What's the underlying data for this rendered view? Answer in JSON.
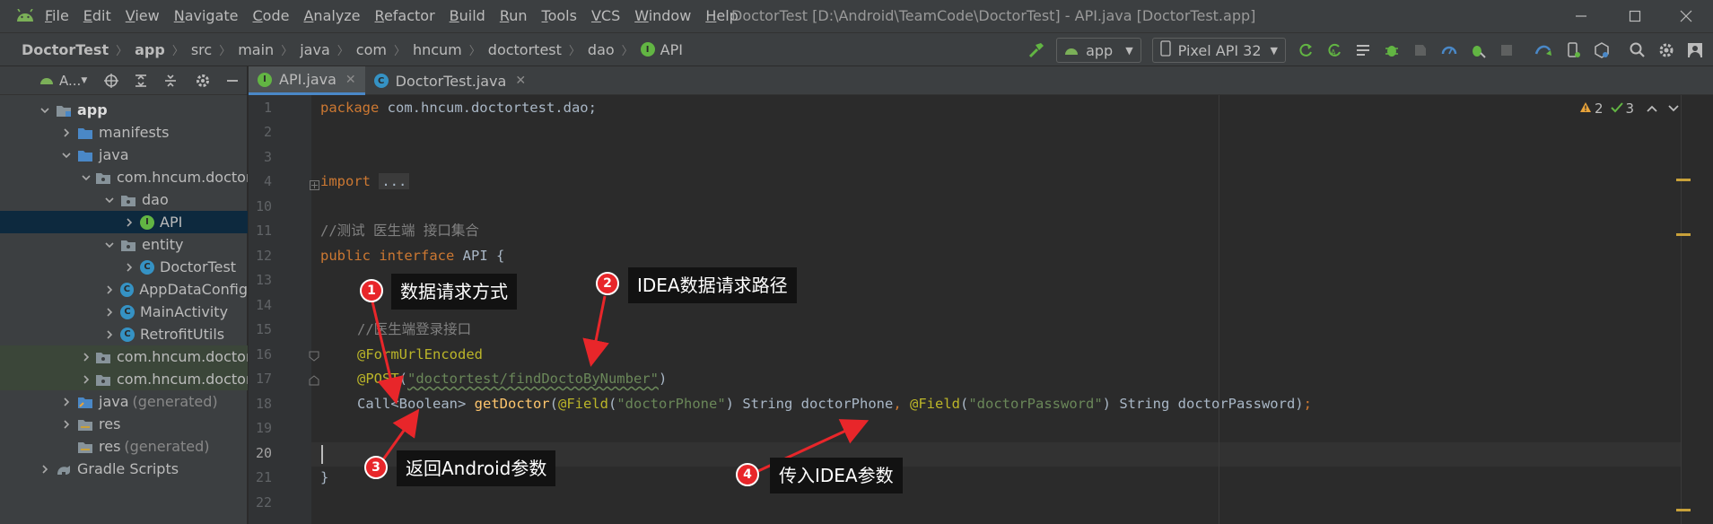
{
  "menu": {
    "items": [
      "File",
      "Edit",
      "View",
      "Navigate",
      "Code",
      "Analyze",
      "Refactor",
      "Build",
      "Run",
      "Tools",
      "VCS",
      "Window",
      "Help"
    ],
    "window_title": "DoctorTest [D:\\Android\\TeamCode\\DoctorTest] - API.java [DoctorTest.app]"
  },
  "breadcrumb": {
    "items": [
      "DoctorTest",
      "app",
      "src",
      "main",
      "java",
      "com",
      "hncum",
      "doctortest",
      "dao",
      "API"
    ]
  },
  "toolbar": {
    "run_config": "app",
    "device": "Pixel API 32"
  },
  "project": {
    "header": "A..."
  },
  "tree": {
    "app": "app",
    "manifests": "manifests",
    "java": "java",
    "pkg": "com.hncum.doctor",
    "dao": "dao",
    "api": "API",
    "entity": "entity",
    "doctortest": "DoctorTest",
    "appdataconfig": "AppDataConfig",
    "mainactivity": "MainActivity",
    "retrofitutils": "RetrofitUtils",
    "pkg2": "com.hncum.doctor",
    "pkg3": "com.hncum.doctor",
    "java_gen": "java",
    "java_gen_suffix": "(generated)",
    "res": "res",
    "res_gen": "res",
    "res_gen_suffix": "(generated)",
    "gradle": "Gradle Scripts"
  },
  "tabs": [
    {
      "label": "API.java"
    },
    {
      "label": "DoctorTest.java"
    }
  ],
  "editor": {
    "line_numbers": [
      "1",
      "2",
      "3",
      "4",
      "10",
      "11",
      "12",
      "13",
      "14",
      "15",
      "16",
      "17",
      "18",
      "19",
      "20",
      "21",
      "22"
    ],
    "pkg_kw": "package",
    "pkg_name": " com.hncum.doctortest.dao;",
    "import_kw": "import",
    "import_fold": "...",
    "comment1": "//测试 医生端 接口集合",
    "public_kw": "public",
    "interface_kw": " interface",
    "iface_name": " API {",
    "comment2": "//医生端登录接口",
    "ann_form": "@FormUrlEncoded",
    "ann_post": "@POST",
    "post_open": "(",
    "post_path": "\"doctortest/findDoctoByNumber\"",
    "post_close": ")",
    "call_type": "Call<Boolean> ",
    "method_name": "getDoctor",
    "paren_open": "(",
    "field_ann1": "@Field",
    "field_open1": "(",
    "field_str1": "\"doctorPhone\"",
    "field_close1": ")",
    "param1": " String doctorPhone",
    "comma": ", ",
    "field_ann2": "@Field",
    "field_open2": "(",
    "field_str2": "\"doctorPassword\"",
    "field_close2": ")",
    "param2": " String doctorPassword)",
    "semicolon": ";",
    "close_brace": "}",
    "warnings": "2",
    "checks": "3"
  },
  "annotations": [
    {
      "badge": "1",
      "text": "数据请求方式"
    },
    {
      "badge": "2",
      "text": "IDEA数据请求路径"
    },
    {
      "badge": "3",
      "text": "返回Android参数"
    },
    {
      "badge": "4",
      "text": "传入IDEA参数"
    }
  ],
  "colors": {
    "keyword": "#cc7832",
    "string": "#6a8759",
    "comment": "#808080",
    "annotation": "#bbb529",
    "method": "#ffc66d",
    "badge": "#e8262a",
    "arrow": "#e8262a"
  }
}
